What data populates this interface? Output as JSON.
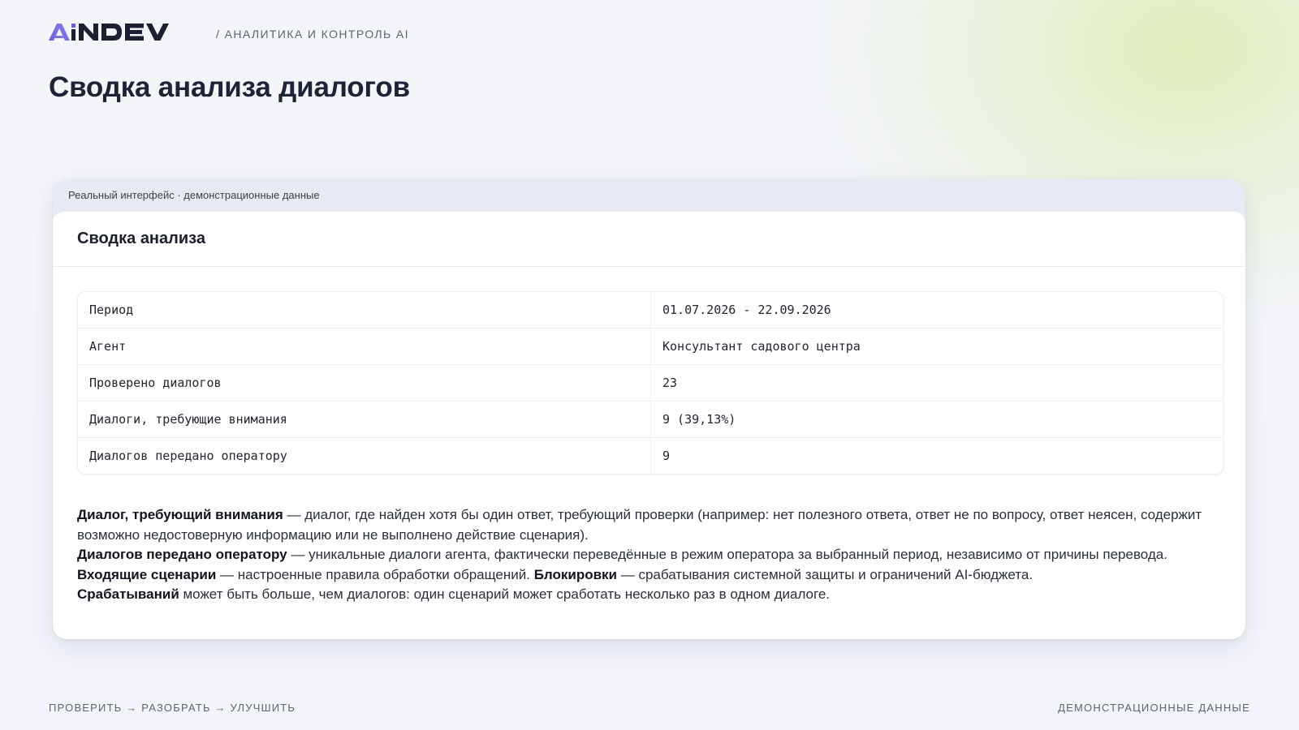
{
  "header": {
    "logo_text": "AiNDEV",
    "tagline": "/ АНАЛИТИКА И КОНТРОЛЬ AI",
    "page_title": "Сводка анализа диалогов"
  },
  "panel": {
    "caption": "Реальный интерфейс · демонстрационные данные",
    "card_title": "Сводка анализа",
    "rows": [
      {
        "label": "Период",
        "value": "01.07.2026 - 22.09.2026"
      },
      {
        "label": "Агент",
        "value": "Консультант садового центра"
      },
      {
        "label": "Проверено диалогов",
        "value": "23"
      },
      {
        "label": "Диалоги, требующие внимания",
        "value": "9 (39,13%)"
      },
      {
        "label": "Диалогов передано оператору",
        "value": "9"
      }
    ],
    "notes": {
      "n1_term": "Диалог, требующий внимания",
      "n1_text": " — диалог, где найден хотя бы один ответ, требующий проверки (например: нет полезного ответа, ответ не по вопросу, ответ неясен, содержит возможно недостоверную информацию или не выполнено действие сценария).",
      "n2_term": "Диалогов передано оператору",
      "n2_text": " — уникальные диалоги агента, фактически переведённые в режим оператора за выбранный период, независимо от причины перевода.",
      "n3_term": "Входящие сценарии",
      "n3_text": " — настроенные правила обработки обращений. ",
      "n3_term2": "Блокировки",
      "n3_text2": " — срабатывания системной защиты и ограничений AI-бюджета.",
      "n4_term": "Срабатываний",
      "n4_text": " может быть больше, чем диалогов: один сценарий может сработать несколько раз в одном диалоге."
    }
  },
  "footer": {
    "left": "ПРОВЕРИТЬ → РАЗОБРАТЬ → УЛУЧШИТЬ",
    "right": "ДЕМОНСТРАЦИОННЫЕ ДАННЫЕ"
  },
  "colors": {
    "logo_accent": "#6f5fe0",
    "logo_dark": "#1c2030",
    "title": "#1e2438"
  }
}
